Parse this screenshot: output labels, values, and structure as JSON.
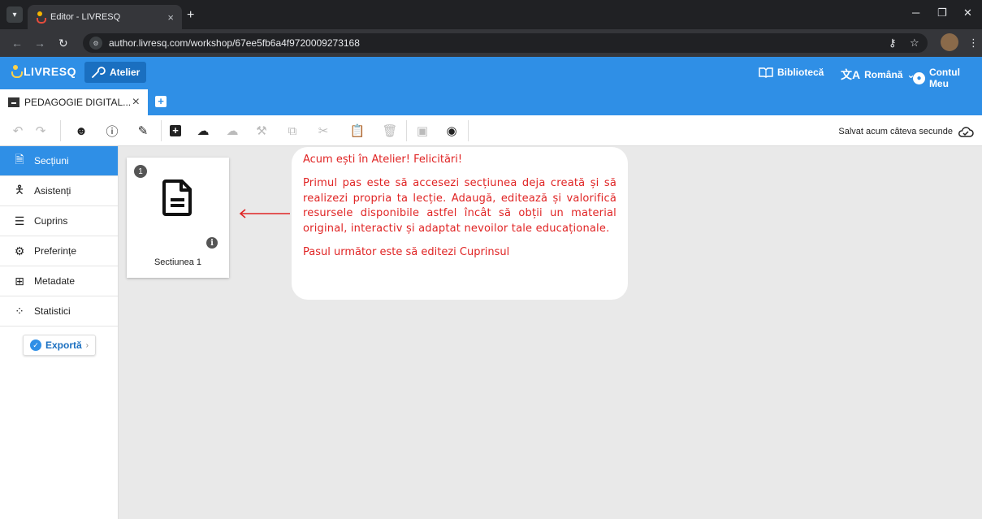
{
  "browser": {
    "tab_title": "Editor - LIVRESQ",
    "url": "author.livresq.com/workshop/67ee5fb6a4f9720009273168"
  },
  "app": {
    "logo_text": "LIVRESQ",
    "atelier_label": "Atelier",
    "library_label": "Bibliotecă",
    "language_label": "Română",
    "account_label": "Contul Meu"
  },
  "doc_tab": {
    "title": "PEDAGOGIE DIGITAL..."
  },
  "toolbar": {
    "saved_status": "Salvat acum câteva secunde"
  },
  "sidebar": {
    "items": [
      {
        "label": "Secțiuni",
        "icon": "document-icon",
        "active": true
      },
      {
        "label": "Asistenți",
        "icon": "person-icon"
      },
      {
        "label": "Cuprins",
        "icon": "list-icon"
      },
      {
        "label": "Preferințe",
        "icon": "gear-icon"
      },
      {
        "label": "Metadate",
        "icon": "metadata-icon"
      },
      {
        "label": "Statistici",
        "icon": "chart-icon"
      }
    ],
    "export_label": "Exportă"
  },
  "section_card": {
    "number": "1",
    "label": "Sectiunea 1"
  },
  "tutorial": {
    "title": "Acum ești în Atelier! Felicitări!",
    "body": "Primul pas este să accesezi secțiunea deja creată și să realizezi propria ta lecție. Adaugă, editează și valorifică resursele disponibile astfel încât să obții un material original, interactiv și adaptat nevoilor tale educaționale.",
    "next": "Pasul următor este să editezi Cuprinsul"
  },
  "colors": {
    "brand": "#2f8fe6",
    "tutorial_text": "#e02424"
  }
}
